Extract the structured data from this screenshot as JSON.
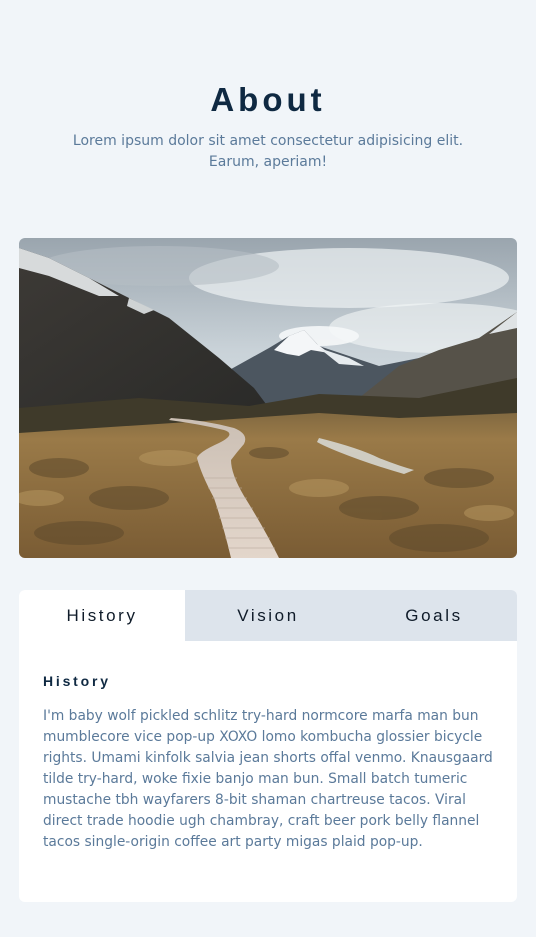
{
  "header": {
    "title": "About",
    "subtitle": "Lorem ipsum dolor sit amet consectetur adipisicing elit. Earum, aperiam!"
  },
  "hero": {
    "image_subject": "mountain valley with wooden boardwalk"
  },
  "tabs": {
    "items": [
      {
        "label": "History",
        "active": true
      },
      {
        "label": "Vision",
        "active": false
      },
      {
        "label": "Goals",
        "active": false
      }
    ],
    "panel": {
      "heading": "History",
      "body": "I'm baby wolf pickled schlitz try-hard normcore marfa man bun mumblecore vice pop-up XOXO lomo kombucha glossier bicycle rights. Umami kinfolk salvia jean shorts offal venmo. Knausgaard tilde try-hard, woke fixie banjo man bun. Small batch tumeric mustache tbh wayfarers 8-bit shaman chartreuse tacos. Viral direct trade hoodie ugh chambray, craft beer pork belly flannel tacos single-origin coffee art party migas plaid pop-up."
    }
  },
  "colors": {
    "page_background": "#f1f5f9",
    "title": "#0f2942",
    "muted_text": "#5b7a9a",
    "inactive_tab": "#dde4ec",
    "active_tab": "#ffffff"
  }
}
